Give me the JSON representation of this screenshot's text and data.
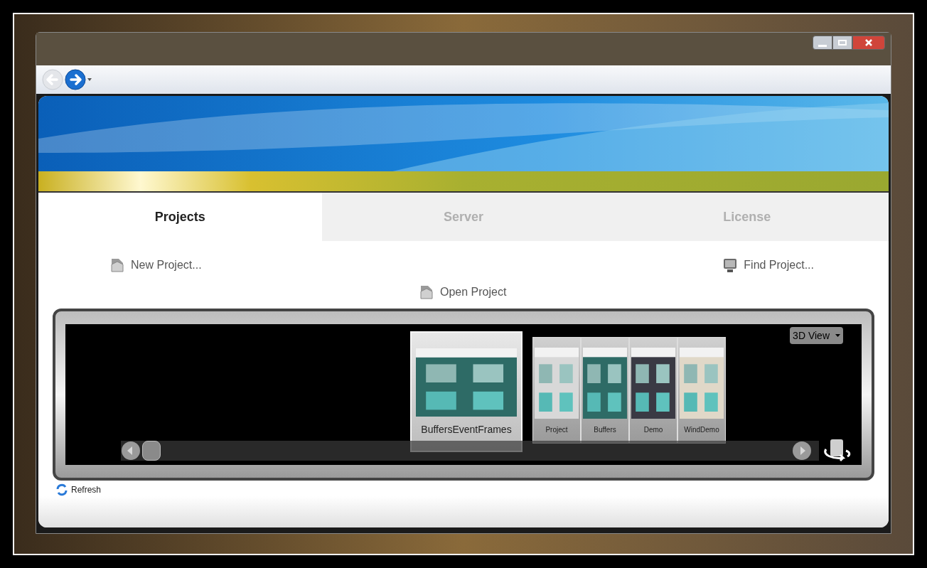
{
  "nav": [
    {
      "kind": "back",
      "disabled": true
    },
    {
      "kind": "forward",
      "disabled": false
    }
  ],
  "tabs": [
    {
      "label": "Projects",
      "selected": true
    },
    {
      "label": "Server",
      "selected": false
    },
    {
      "label": "License",
      "selected": false
    }
  ],
  "actions": [
    {
      "kind": "new",
      "label": "New Project..."
    },
    {
      "kind": "find",
      "label": "Find Project..."
    },
    {
      "kind": "open",
      "label": "Open Project"
    }
  ],
  "view_menu": {
    "label": "3D View"
  },
  "projects": [
    {
      "label": "BuffersEventFrames",
      "selected": true
    },
    {
      "label": "Project",
      "selected": false
    },
    {
      "label": "Buffers",
      "selected": false
    },
    {
      "label": "Demo",
      "selected": false
    },
    {
      "label": "WindDemo",
      "selected": false
    }
  ],
  "refresh": {
    "label": "Refresh"
  }
}
